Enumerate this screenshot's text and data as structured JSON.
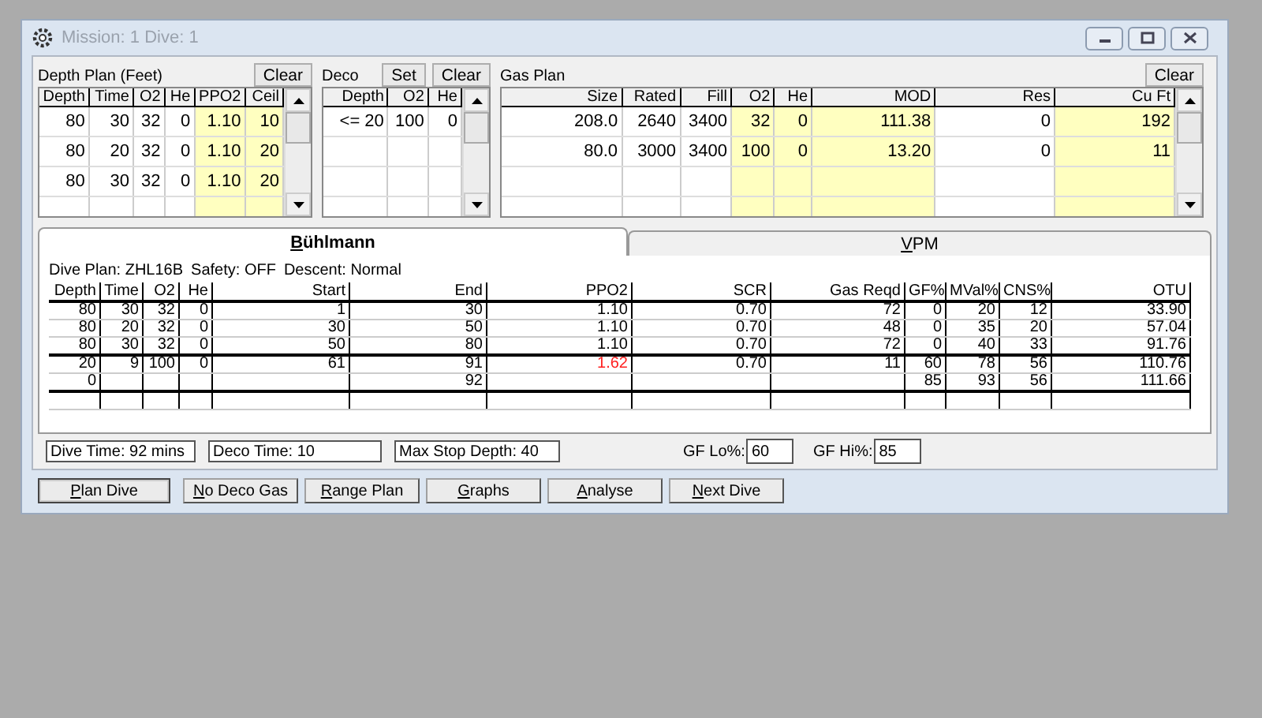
{
  "window": {
    "title": "Mission: 1 Dive: 1"
  },
  "depth_plan": {
    "title": "Depth Plan (Feet)",
    "clear": "Clear",
    "columns": [
      {
        "label": "Depth",
        "shaded": false
      },
      {
        "label": "Time",
        "shaded": false
      },
      {
        "label": "O2",
        "shaded": false
      },
      {
        "label": "He",
        "shaded": false
      },
      {
        "label": "PPO2",
        "shaded": true
      },
      {
        "label": "Ceil",
        "shaded": true
      }
    ],
    "rows": [
      [
        "80",
        "30",
        "32",
        "0",
        "1.10",
        "10"
      ],
      [
        "80",
        "20",
        "32",
        "0",
        "1.10",
        "20"
      ],
      [
        "80",
        "30",
        "32",
        "0",
        "1.10",
        "20"
      ]
    ]
  },
  "deco": {
    "title": "Deco",
    "set": "Set",
    "clear": "Clear",
    "columns": [
      {
        "label": "Depth",
        "shaded": false
      },
      {
        "label": "O2",
        "shaded": false
      },
      {
        "label": "He",
        "shaded": false
      }
    ],
    "rows": [
      [
        "<= 20",
        "100",
        "0"
      ]
    ]
  },
  "gas_plan": {
    "title": "Gas Plan",
    "clear": "Clear",
    "columns": [
      {
        "label": "Size",
        "shaded": false
      },
      {
        "label": "Rated",
        "shaded": false
      },
      {
        "label": "Fill",
        "shaded": false
      },
      {
        "label": "O2",
        "shaded": true
      },
      {
        "label": "He",
        "shaded": true
      },
      {
        "label": "MOD",
        "shaded": true
      },
      {
        "label": "Res",
        "shaded": false
      },
      {
        "label": "Cu Ft",
        "shaded": true
      }
    ],
    "rows": [
      [
        "208.0",
        "2640",
        "3400",
        "32",
        "0",
        "111.38",
        "0",
        "192"
      ],
      [
        "80.0",
        "3000",
        "3400",
        "100",
        "0",
        "13.20",
        "0",
        "11"
      ]
    ]
  },
  "tabs": [
    {
      "label": "Bühlmann",
      "selected": true
    },
    {
      "label": "VPM",
      "selected": false
    }
  ],
  "plan_info": [
    "Dive Plan: ZHL16B",
    "Safety: OFF",
    "Descent: Normal"
  ],
  "results": {
    "columns": [
      "Depth",
      "Time",
      "O2",
      "He",
      "Start",
      "End",
      "PPO2",
      "SCR",
      "Gas Reqd",
      "GF%",
      "MVal%",
      "CNS%",
      "OTU"
    ],
    "rows": [
      {
        "cells": [
          "80",
          "30",
          "32",
          "0",
          "1",
          "30",
          "1.10",
          "0.70",
          "72",
          "0",
          "20",
          "12",
          "33.90"
        ],
        "ppo2_warning": false
      },
      {
        "cells": [
          "80",
          "20",
          "32",
          "0",
          "30",
          "50",
          "1.10",
          "0.70",
          "48",
          "0",
          "35",
          "20",
          "57.04"
        ],
        "ppo2_warning": false
      },
      {
        "cells": [
          "80",
          "30",
          "32",
          "0",
          "50",
          "80",
          "1.10",
          "0.70",
          "72",
          "0",
          "40",
          "33",
          "91.76"
        ],
        "ppo2_warning": false
      },
      {
        "cells": [
          "20",
          "9",
          "100",
          "0",
          "61",
          "91",
          "1.62",
          "0.70",
          "11",
          "60",
          "78",
          "56",
          "110.76"
        ],
        "ppo2_warning": true
      },
      {
        "cells": [
          "0",
          "",
          "",
          "",
          "",
          "92",
          "",
          "",
          "",
          "85",
          "93",
          "56",
          "111.66"
        ]
      }
    ]
  },
  "summary": {
    "dive_time": "Dive Time: 92 mins",
    "deco_time": "Deco Time: 10",
    "max_stop_depth": "Max Stop Depth: 40",
    "gf_lo_label": "GF Lo%:",
    "gf_lo": "60",
    "gf_hi_label": "GF Hi%:",
    "gf_hi": "85"
  },
  "buttons": [
    {
      "label": "Plan Dive",
      "default": true
    },
    {
      "label": "No Deco Gas",
      "default": false
    },
    {
      "label": "Range Plan",
      "default": false
    },
    {
      "label": "Graphs",
      "default": false
    },
    {
      "label": "Analyse",
      "default": false
    },
    {
      "label": "Next Dive",
      "default": false
    }
  ]
}
